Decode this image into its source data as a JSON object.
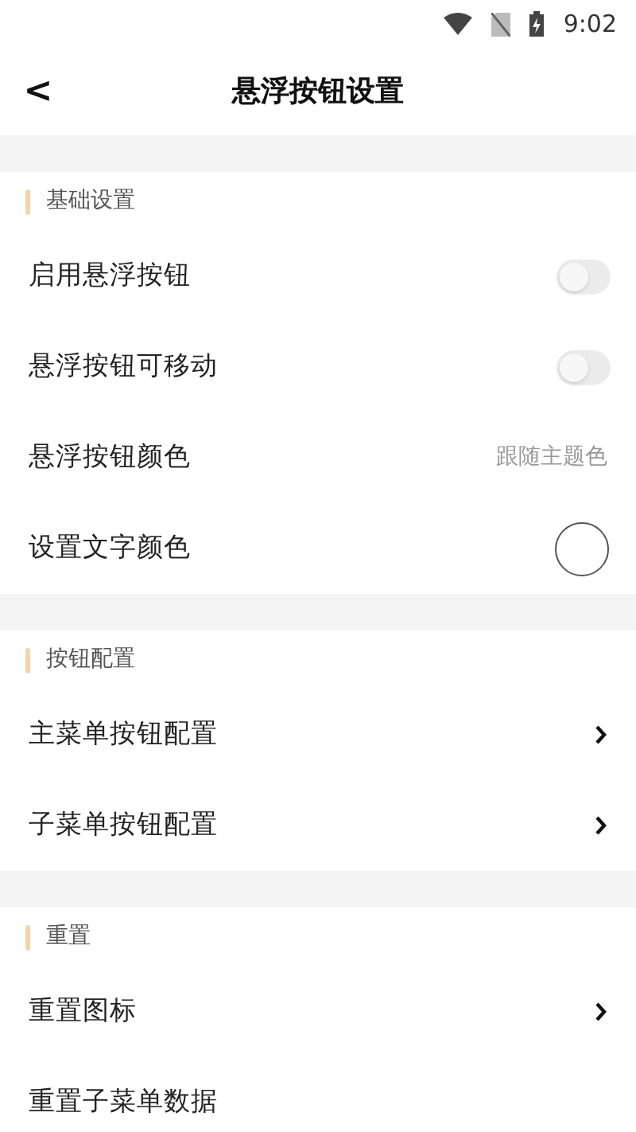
{
  "status_bar": {
    "time": "9:02"
  },
  "header": {
    "back": "<",
    "title": "悬浮按钮设置"
  },
  "sections": [
    {
      "title": "基础设置",
      "rows": [
        {
          "kind": "toggle",
          "label": "启用悬浮按钮",
          "on": false
        },
        {
          "kind": "toggle",
          "label": "悬浮按钮可移动",
          "on": false
        },
        {
          "kind": "value",
          "label": "悬浮按钮颜色",
          "value": "跟随主题色"
        },
        {
          "kind": "color",
          "label": "设置文字颜色",
          "color": "#ffffff"
        }
      ]
    },
    {
      "title": "按钮配置",
      "rows": [
        {
          "kind": "link",
          "label": "主菜单按钮配置"
        },
        {
          "kind": "link",
          "label": "子菜单按钮配置"
        }
      ]
    },
    {
      "title": "重置",
      "rows": [
        {
          "kind": "link",
          "label": "重置图标"
        },
        {
          "kind": "plain",
          "label": "重置子菜单数据"
        }
      ]
    }
  ]
}
